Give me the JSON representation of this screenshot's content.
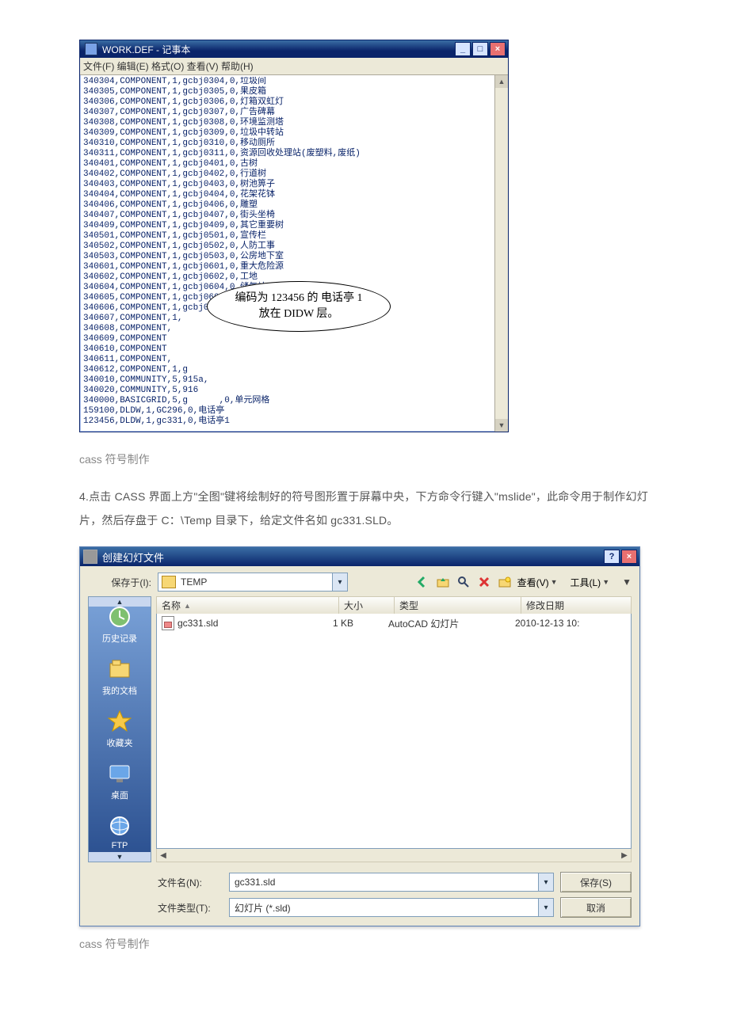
{
  "notepad": {
    "title": "WORK.DEF - 记事本",
    "menus": "文件(F)  编辑(E)  格式(O)  查看(V)  帮助(H)",
    "lines": [
      "340304,COMPONENT,1,gcbj0304,0,垃圾间",
      "340305,COMPONENT,1,gcbj0305,0,果皮箱",
      "340306,COMPONENT,1,gcbj0306,0,灯箱双虹灯",
      "340307,COMPONENT,1,gcbj0307,0,广告碑幕",
      "340308,COMPONENT,1,gcbj0308,0,环境监测塔",
      "340309,COMPONENT,1,gcbj0309,0,垃圾中转站",
      "340310,COMPONENT,1,gcbj0310,0,移动厕所",
      "340311,COMPONENT,1,gcbj0311,0,资源回收处理站(废塑料,废纸)",
      "340401,COMPONENT,1,gcbj0401,0,古树",
      "340402,COMPONENT,1,gcbj0402,0,行道树",
      "340403,COMPONENT,1,gcbj0403,0,树池箅子",
      "340404,COMPONENT,1,gcbj0404,0,花架花钵",
      "340406,COMPONENT,1,gcbj0406,0,雕塑",
      "340407,COMPONENT,1,gcbj0407,0,街头坐椅",
      "340409,COMPONENT,1,gcbj0409,0,其它重要树",
      "340501,COMPONENT,1,gcbj0501,0,宣传栏",
      "340502,COMPONENT,1,gcbj0502,0,人防工事",
      "340503,COMPONENT,1,gcbj0503,0,公房地下室",
      "340601,COMPONENT,1,gcbj0601,0,重大危险源",
      "340602,COMPONENT,1,gcbj0602,0,工地",
      "340604,COMPONENT,1,gcbj0604,0,储气站",
      "340605,COMPONENT,1,gcbj0605,0,",
      "340606,COMPONENT,1,gcbj0",
      "340607,COMPONENT,1,",
      "340608,COMPONENT,",
      "340609,COMPONENT",
      "340610,COMPONENT",
      "340611,COMPONENT,",
      "340612,COMPONENT,1,g",
      "340010,COMMUNITY,5,915a,",
      "340020,COMMUNITY,5,916",
      "340000,BASICGRID,5,g      ,0,单元网格",
      "159100,DLDW,1,GC296,0,电话亭",
      "123456,DLDW,1,gc331,0,电话亭1"
    ],
    "callout": {
      "line1": "编码为 123456 的 电话亭 1",
      "line2": "放在 DIDW 层。"
    }
  },
  "caption": "cass 符号制作",
  "paragraph": "4.点击 CASS 界面上方\"全图\"键将绘制好的符号图形置于屏幕中央，下方命令行键入\"mslide\"，此命令用于制作幻灯片，然后存盘于 C：\\Temp 目录下，给定文件名如 gc331.SLD。",
  "dialog": {
    "title": "创建幻灯文件",
    "save_in_label": "保存于(I):",
    "save_in_value": "TEMP",
    "view_label": "查看(V)",
    "tool_label": "工具(L)",
    "side": {
      "history": "历史记录",
      "mydocs": "我的文档",
      "favorites": "收藏夹",
      "desktop": "桌面",
      "ftp": "FTP"
    },
    "header": {
      "name": "名称",
      "size": "大小",
      "type": "类型",
      "date": "修改日期"
    },
    "file": {
      "name": "gc331.sld",
      "size": "1 KB",
      "type": "AutoCAD 幻灯片",
      "date": "2010-12-13 10:"
    },
    "filename_label": "文件名(N):",
    "filename_value": "gc331.sld",
    "filetype_label": "文件类型(T):",
    "filetype_value": "幻灯片 (*.sld)",
    "save_btn": "保存(S)",
    "cancel_btn": "取消"
  }
}
